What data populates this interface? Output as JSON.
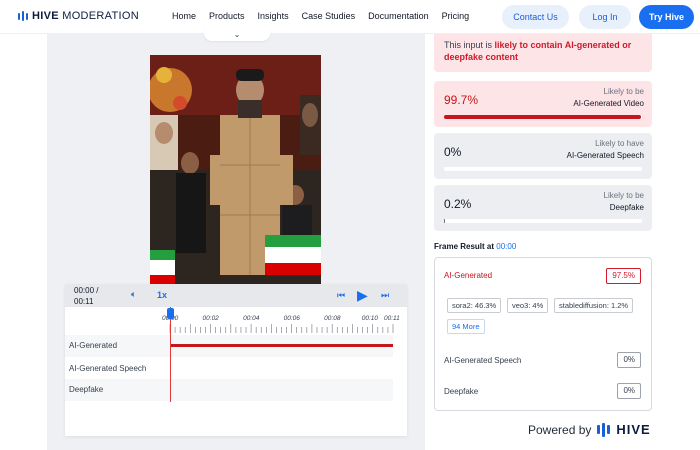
{
  "header": {
    "logo_bold": "HIVE",
    "logo_rest": "MODERATION",
    "nav": [
      "Home",
      "Products",
      "Insights",
      "Case Studies",
      "Documentation",
      "Pricing"
    ],
    "contact_label": "Contact Us",
    "login_label": "Log In",
    "try_label": "Try Hive"
  },
  "player": {
    "time_current": "00:00 /",
    "time_total": "00:11",
    "speed": "1x",
    "ruler_ticks": [
      "00:00",
      "00:02",
      "00:04",
      "00:06",
      "00:08",
      "00:10",
      "00:11"
    ],
    "tracks": [
      "AI-Generated",
      "AI-Generated Speech",
      "Deepfake"
    ]
  },
  "results": {
    "alert_prefix": "This input is ",
    "alert_bold": "likely to contain AI-generated or deepfake content",
    "cards": [
      {
        "pct": "99.7%",
        "top": "Likely to be",
        "bottom": "AI-Generated Video",
        "fill": 0.997
      },
      {
        "pct": "0%",
        "top": "Likely to have",
        "bottom": "AI-Generated Speech",
        "fill": 0.0
      },
      {
        "pct": "0.2%",
        "top": "Likely to be",
        "bottom": "Deepfake",
        "fill": 0.002
      }
    ],
    "frame_title": "Frame Result at ",
    "frame_time": "00:00",
    "ai_generated_label": "AI-Generated",
    "ai_generated_score": "97.5%",
    "chips": [
      "sora2: 46.3%",
      "veo3: 4%",
      "stablediffusion: 1.2%"
    ],
    "more_label": "94 More",
    "speech_label": "AI-Generated Speech",
    "speech_score": "0%",
    "deepfake_label": "Deepfake",
    "deepfake_score": "0%"
  },
  "footer": {
    "powered_by": "Powered by",
    "brand": "HIVE"
  },
  "colors": {
    "accent": "#1a6ff0",
    "alert": "#c4161c"
  }
}
